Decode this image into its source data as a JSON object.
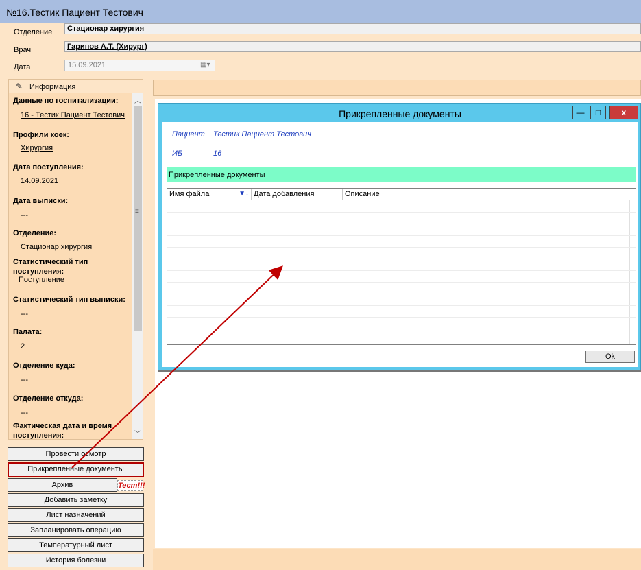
{
  "window": {
    "title": "№16.Тестик Пациент Тестович"
  },
  "form": {
    "department_label": "Отделение",
    "department_value": "Стационар  хирургия",
    "doctor_label": "Врач",
    "doctor_value": "Гарипов А.Т. (Хирург)",
    "date_label": "Дата",
    "date_value": "15.09.2021"
  },
  "info_panel": {
    "header": "Информация",
    "items": [
      {
        "title": "Данные по госпитализации:",
        "value": "16 - Тестик Пациент Тестович"
      },
      {
        "title": "Профили коек:",
        "value": "Хирургия"
      },
      {
        "title": "Дата поступления:",
        "value": "14.09.2021"
      },
      {
        "title": "Дата выписки:",
        "value": "---"
      },
      {
        "title": "Отделение:",
        "value": "Стационар  хирургия"
      },
      {
        "title": "Статистический тип",
        "title2": "поступления:",
        "value": "Поступление"
      },
      {
        "title": "Статистический тип выписки:",
        "value": "---"
      },
      {
        "title": "Палата:",
        "value": "2"
      },
      {
        "title": "Отделение куда:",
        "value": "---"
      },
      {
        "title": "Отделение откуда:",
        "value": "---"
      },
      {
        "title": "Фактическая дата и время",
        "title2": "поступления:"
      }
    ]
  },
  "buttons": {
    "examine": "Провести осмотр",
    "attached_docs": "Прикрепленные документы",
    "archive": "Архив",
    "test_badge": "Тест!!!",
    "add_note": "Добавить заметку",
    "prescriptions": "Лист назначений",
    "plan_operation": "Запланировать операцию",
    "temperature_sheet": "Температурный лист",
    "history": "История болезни"
  },
  "dialog": {
    "title": "Прикрепленные документы",
    "patient_label": "Пациент",
    "patient_value": "Тестик Пациент Тестович",
    "ib_label": "ИБ",
    "ib_value": "16",
    "section_title": "Прикрепленные документы",
    "columns": [
      "Имя файла",
      "Дата добавления",
      "Описание"
    ],
    "ok_label": "Ok",
    "min_glyph": "—",
    "max_glyph": "□",
    "close_glyph": "x"
  },
  "colors": {
    "background": "#fde5c8",
    "panel": "#fcdcb6",
    "dialog_frame": "#5bc8eb",
    "docs_bar": "#7cfcc8",
    "highlight": "#b00000",
    "link_blue": "#1f3fbf"
  }
}
